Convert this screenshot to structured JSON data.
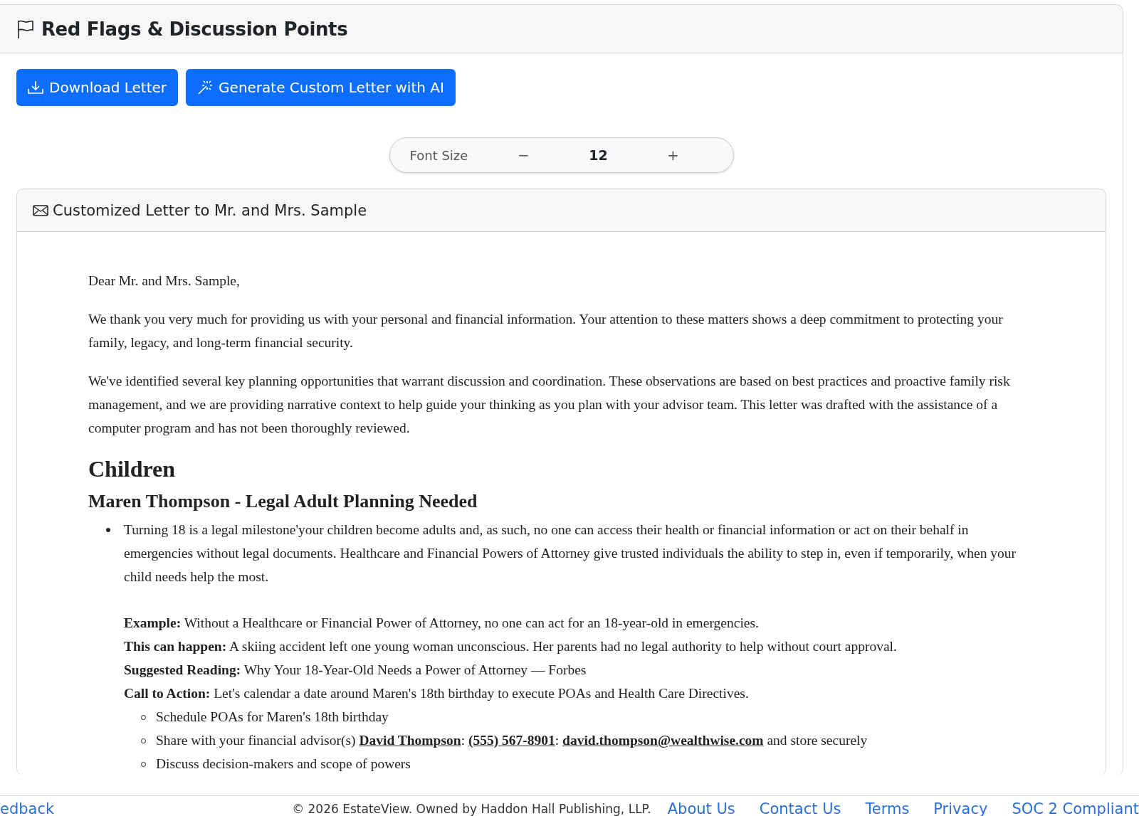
{
  "panel": {
    "title": "Red Flags & Discussion Points"
  },
  "actions": [
    {
      "kind": "download",
      "label": "Download Letter"
    },
    {
      "kind": "magic",
      "label": "Generate Custom Letter with AI"
    }
  ],
  "font_size": {
    "label": "Font Size",
    "decrease": "−",
    "value": "12",
    "increase": "+"
  },
  "letter": {
    "title": "Customized Letter to Mr. and Mrs. Sample",
    "greeting": "Dear Mr. and Mrs. Sample,",
    "paragraphs": [
      "We thank you very much for providing us with your personal and financial information. Your attention to these matters shows a deep commitment to protecting your family, legacy, and long-term financial security.",
      "We've identified several key planning opportunities that warrant discussion and coordination. These observations are based on best practices and proactive family risk management, and we are providing narrative context to help guide your thinking as you plan with your advisor team. This letter was drafted with the assistance of a computer program and has not been thoroughly reviewed."
    ],
    "section": "Children",
    "subsection": "Maren Thompson - Legal Adult Planning Needed",
    "item": {
      "text": "Turning 18 is a legal milestone'your children become adults and, as such, no one can access their health or financial information or act on their behalf in emergencies without legal documents. Healthcare and Financial Powers of Attorney give trusted individuals the ability to step in, even if temporarily, when your child needs help the most.",
      "details": [
        "**Example:** Without a Healthcare or Financial Power of Attorney, no one can act for an 18-year-old in emergencies.",
        "**This can happen:** A skiing accident left one young woman unconscious. Her parents had no legal authority to help without court approval.",
        "**Suggested Reading:** Why Your 18-Year-Old Needs a Power of Attorney — Forbes",
        "**Call to Action:** Let's calendar a date around Maren's 18th birthday to execute POAs and Health Care Directives."
      ],
      "tasks": [
        [
          {
            "kind": "text",
            "text": "Schedule POAs for Maren's 18th birthday"
          }
        ],
        [
          {
            "kind": "text",
            "text": "Share with your financial advisor(s) "
          },
          {
            "kind": "link",
            "text": "David Thompson"
          },
          {
            "kind": "text",
            "text": ": "
          },
          {
            "kind": "link",
            "text": "(555) 567-8901"
          },
          {
            "kind": "text",
            "text": ": "
          },
          {
            "kind": "link",
            "text": "david.thompson@wealthwise.com"
          },
          {
            "kind": "text",
            "text": " and store securely"
          }
        ],
        [
          {
            "kind": "text",
            "text": "Discuss decision-makers and scope of powers"
          }
        ]
      ]
    }
  },
  "footer": {
    "left_link": "edback",
    "copyright": "© 2026 EstateView. Owned by Haddon Hall Publishing, LLP.",
    "links": [
      "About Us",
      "Contact Us",
      "Terms",
      "Privacy",
      "SOC 2 Compliant"
    ]
  }
}
